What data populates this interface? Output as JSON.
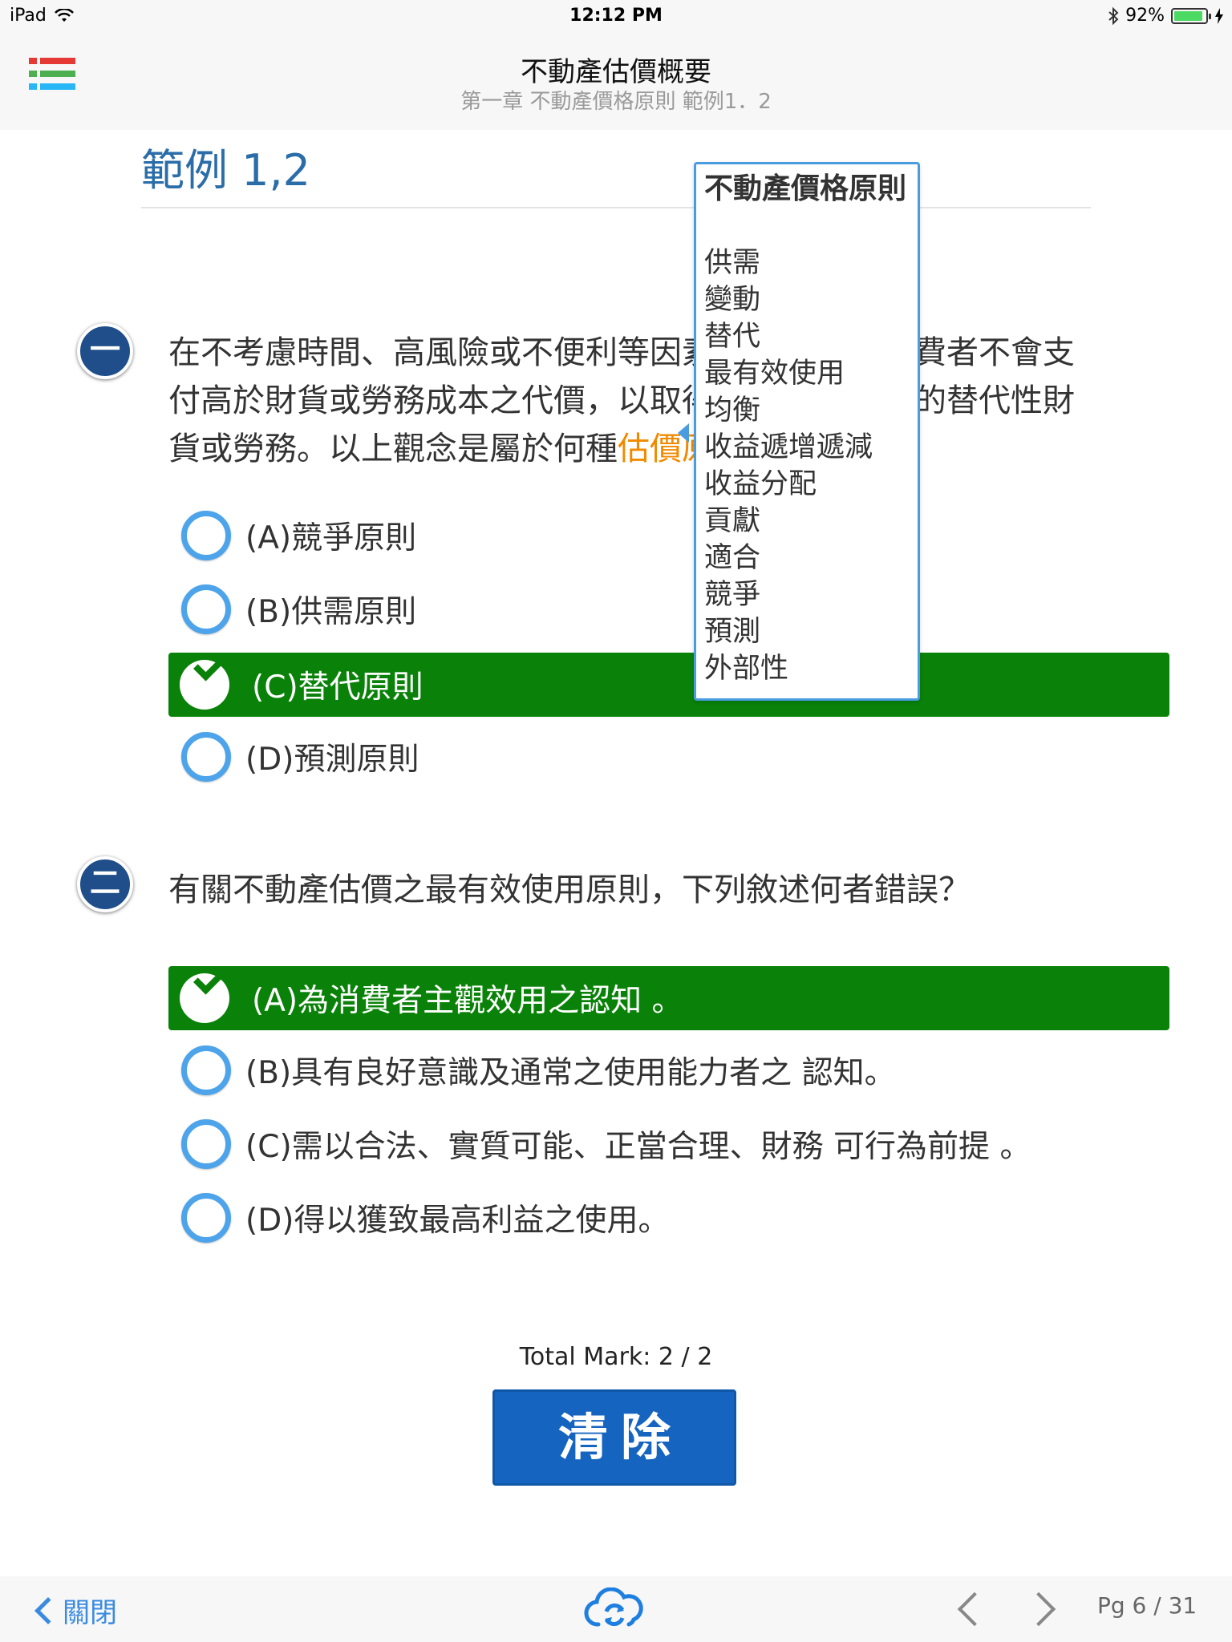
{
  "status": {
    "device": "iPad",
    "time": "12:12 PM",
    "battery": "92%"
  },
  "header": {
    "title": "不動產估價概要",
    "subtitle": "第一章 不動產價格原則 範例1．2",
    "menu_colors": [
      "#e53935",
      "#4caf50",
      "#29b6f6"
    ]
  },
  "section": {
    "title": "範例 1,2"
  },
  "questions": [
    {
      "number": "一",
      "lines": [
        "在不考慮時間、高風險或不便利等因素",
        "付高於財貨或勞務成本之代價，以取得",
        "貨或勞務。以上觀念是屬於何種"
      ],
      "line1_tail": "費者不會支",
      "line2_tail": "的替代性財",
      "highlight": "估價原",
      "options": [
        {
          "label": "(A)競爭原則",
          "state": "unselected"
        },
        {
          "label": "(B)供需原則",
          "state": "unselected"
        },
        {
          "label": "(C)替代原則",
          "state": "correct"
        },
        {
          "label": "(D)預測原則",
          "state": "unselected"
        }
      ]
    },
    {
      "number": "二",
      "text": "有關不動產估價之最有效使用原則，下列敘述何者錯誤？",
      "options": [
        {
          "label": "(A)為消費者主觀效用之認知 。",
          "state": "correct"
        },
        {
          "label": "(B)具有良好意識及通常之使用能力者之 認知。",
          "state": "unselected"
        },
        {
          "label": "(C)需以合法、實質可能、正當合理、財務 可行為前提 。",
          "state": "unselected"
        },
        {
          "label": "(D)得以獲致最高利益之使用。",
          "state": "unselected"
        }
      ]
    }
  ],
  "popup": {
    "title": "不動產價格原則",
    "items": [
      "供需",
      "變動",
      "替代",
      "最有效使用",
      "均衡",
      "收益遞增遞減",
      "收益分配",
      "貢獻",
      "適合",
      "競爭",
      "預測",
      "外部性"
    ]
  },
  "total": "Total Mark: 2 / 2",
  "clear_button": "清除",
  "footer": {
    "close": "關閉",
    "page": "Pg 6 / 31"
  }
}
